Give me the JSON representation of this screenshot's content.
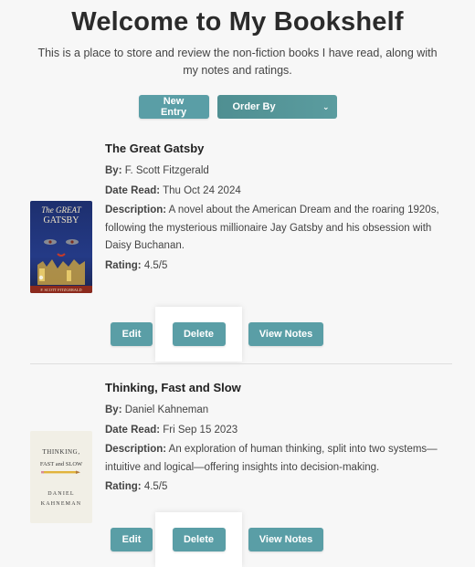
{
  "page": {
    "title": "Welcome to My Bookshelf",
    "intro": "This is a place to store and review the non-fiction books I have read, along with my notes and ratings."
  },
  "controls": {
    "new_entry_label": "New Entry",
    "order_by_label": "Order By"
  },
  "labels": {
    "by": "By:",
    "date_read": "Date Read:",
    "description": "Description:",
    "rating": "Rating:"
  },
  "books": [
    {
      "title": "The Great Gatsby",
      "author": "F. Scott Fitzgerald",
      "date_read": "Thu Oct 24 2024",
      "description": "A novel about the American Dream and the roaring 1920s, following the mysterious millionaire Jay Gatsby and his obsession with Daisy Buchanan.",
      "rating": "4.5/5",
      "cover_text": "The GREAT GATSBY",
      "cover_author": "F. SCOTT FITZGERALD"
    },
    {
      "title": "Thinking, Fast and Slow",
      "author": "Daniel Kahneman",
      "date_read": "Fri Sep 15 2023",
      "description": "An exploration of human thinking, split into two systems—intuitive and logical—offering insights into decision-making.",
      "rating": "4.5/5",
      "cover_text": "THINKING, FAST AND SLOW",
      "cover_author": "DANIEL KAHNEMAN"
    }
  ],
  "actions": {
    "edit_label": "Edit",
    "delete_label": "Delete",
    "view_notes_label": "View Notes"
  },
  "colors": {
    "accent": "#5a9ea6",
    "background": "#f7f7f7"
  }
}
